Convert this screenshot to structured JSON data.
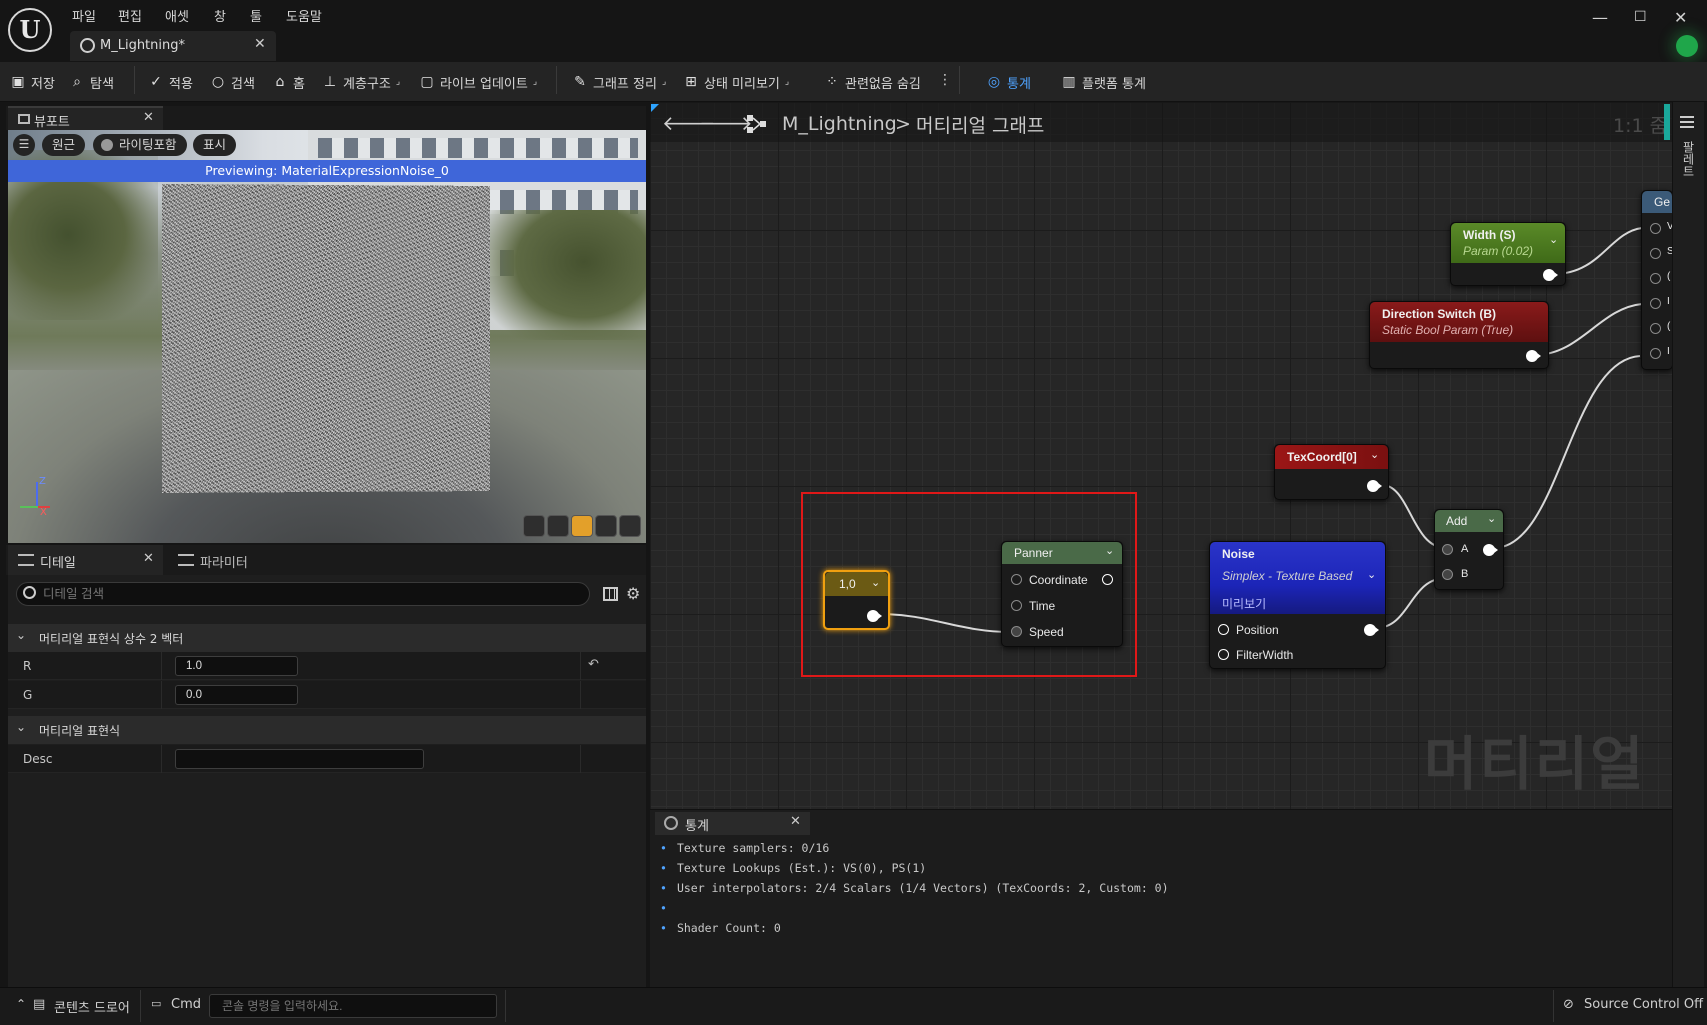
{
  "menu": [
    "파일",
    "편집",
    "애셋",
    "창",
    "툴",
    "도움말"
  ],
  "document_tab": {
    "label": "M_Lightning*"
  },
  "toolbar": {
    "save": "저장",
    "browse": "탐색",
    "apply": "적용",
    "search": "검색",
    "home": "홈",
    "hierarchy": "계층구조",
    "live_update": "라이브 업데이트",
    "clean_graph": "그래프 정리",
    "state_preview": "상태 미리보기",
    "hide_unrelated": "관련없음 숨김",
    "stats": "통계",
    "platform_stats": "플랫폼 통계"
  },
  "viewport": {
    "tab_label": "뷰포트",
    "perspective": "원근",
    "lit": "라이팅포함",
    "show": "표시",
    "preview_banner": "Previewing: MaterialExpressionNoise_0",
    "axis_z": "Z",
    "axis_x": "X"
  },
  "details": {
    "tab_label": "디테일",
    "params_tab_label": "파라미터",
    "search_placeholder": "디테일 검색",
    "section1": "머티리얼 표현식 상수 2 벡터",
    "r_label": "R",
    "r_value": "1.0",
    "g_label": "G",
    "g_value": "0.0",
    "section2": "머티리얼 표현식",
    "desc_label": "Desc",
    "desc_value": ""
  },
  "graph": {
    "breadcrumb_root": "M_Lightning",
    "breadcrumb_sep": ">",
    "breadcrumb_current": "머티리얼 그래프",
    "zoom": "1:1 줌",
    "watermark": "머티리얼",
    "side_tab": "팔레트"
  },
  "nodes": {
    "constant": {
      "title": "1,0"
    },
    "panner": {
      "title": "Panner",
      "pins": [
        "Coordinate",
        "Time",
        "Speed"
      ]
    },
    "noise": {
      "title": "Noise",
      "subtitle": "Simplex - Texture Based",
      "preview": "미리보기",
      "pins": [
        "Position",
        "FilterWidth"
      ]
    },
    "texcoord": {
      "title": "TexCoord[0]"
    },
    "add": {
      "title": "Add",
      "pin_a": "A",
      "pin_b": "B"
    },
    "width": {
      "title": "Width (S)",
      "subtitle": "Param (0.02)"
    },
    "direction": {
      "title": "Direction Switch (B)",
      "subtitle": "Static Bool Param (True)"
    },
    "result_partial": {
      "title": "Ge",
      "pins": [
        "V",
        "S",
        "(",
        "I",
        "(",
        "I"
      ]
    }
  },
  "colors": {
    "constant_header": "#6b5a14",
    "panner_header": "#4a6a48",
    "noise_header": "#1c25b8",
    "texcoord_header": "#9b1616",
    "add_header": "#4a6a48",
    "width_header": "#4f7a22",
    "direction_header": "#7a1616",
    "selection": "#e01818",
    "accent_blue": "#4fa3ff"
  },
  "stats_panel": {
    "tab_label": "통계",
    "lines": [
      "Texture samplers: 0/16",
      "Texture Lookups (Est.): VS(0), PS(1)",
      "User interpolators: 2/4 Scalars (1/4 Vectors) (TexCoords: 2, Custom: 0)",
      "",
      "Shader Count: 0"
    ]
  },
  "statusbar": {
    "content_drawer": "콘텐츠 드로어",
    "cmd": "Cmd",
    "cmd_placeholder": "콘솔 명령을 입력하세요.",
    "source_control": "Source Control Off"
  }
}
